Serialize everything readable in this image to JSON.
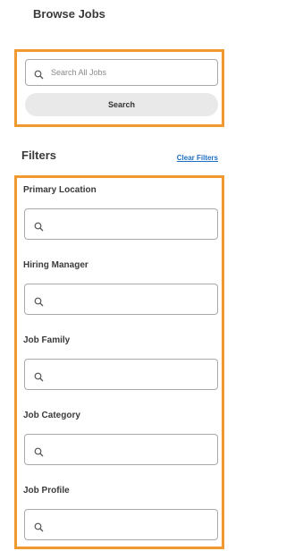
{
  "header": {
    "title": "Browse Jobs"
  },
  "search": {
    "placeholder": "Search All Jobs",
    "value": "",
    "button_label": "Search"
  },
  "filters": {
    "title": "Filters",
    "clear_label": "Clear Filters",
    "items": [
      {
        "label": "Primary Location",
        "value": ""
      },
      {
        "label": "Hiring Manager",
        "value": ""
      },
      {
        "label": "Job Family",
        "value": ""
      },
      {
        "label": "Job Category",
        "value": ""
      },
      {
        "label": "Job Profile",
        "value": ""
      }
    ]
  },
  "colors": {
    "highlight": "#f0992e",
    "link": "#1f6fc5",
    "button_bg": "#e9e9e9"
  },
  "icons": {
    "search": "magnifier-icon"
  }
}
